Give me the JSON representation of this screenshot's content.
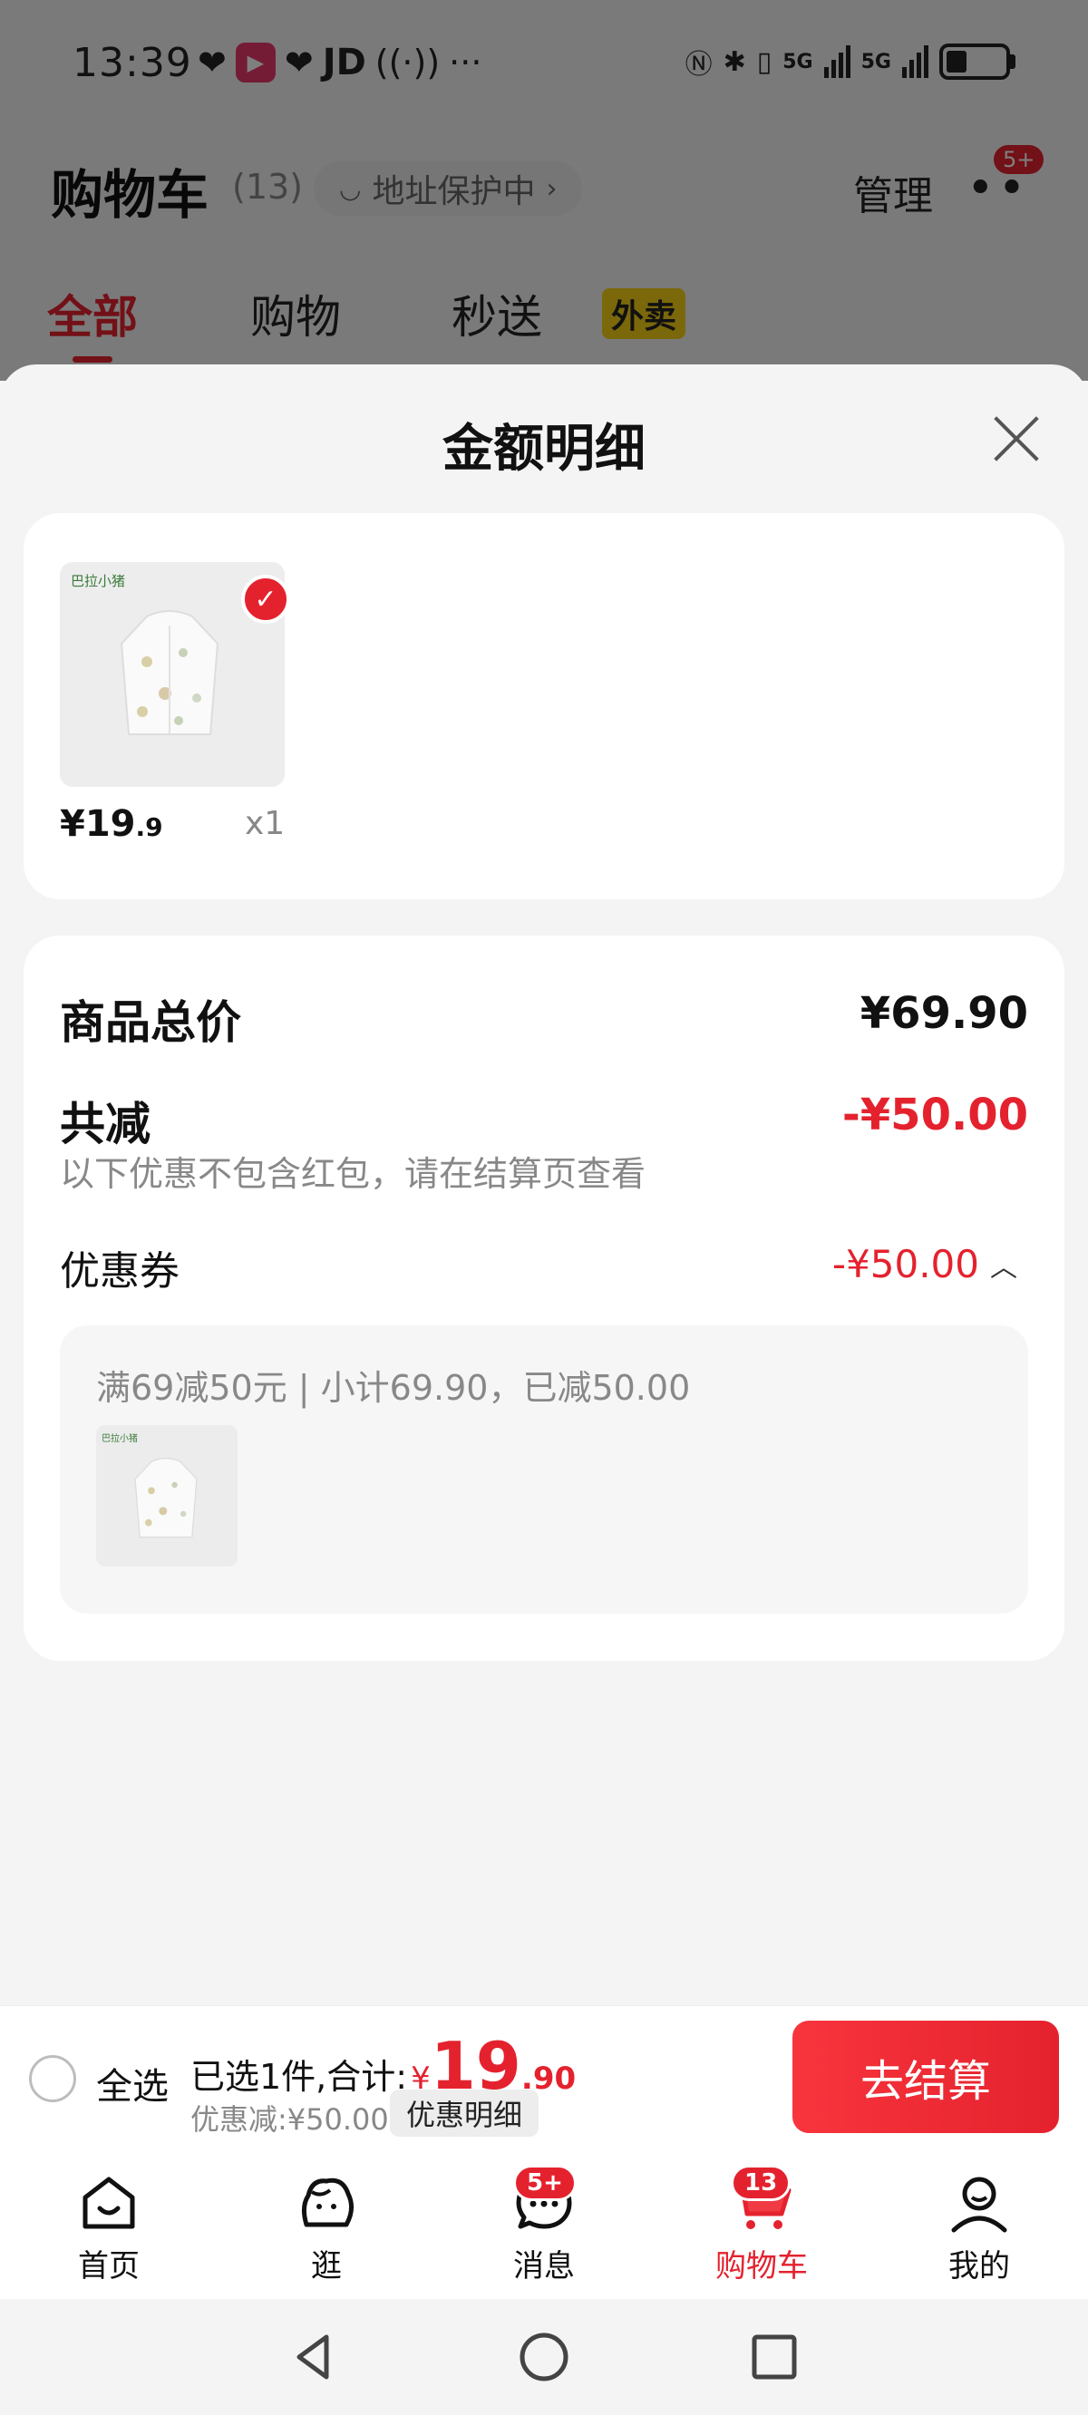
{
  "status_bar": {
    "time": "13:39",
    "left_app": "JD",
    "net_label_1": "5G",
    "net_label_2": "5G"
  },
  "header": {
    "title": "购物车",
    "count": "(13)",
    "address_pill": "地址保护中",
    "manage": "管理",
    "more_badge": "5+"
  },
  "cart_tabs": [
    {
      "label": "全部",
      "active": true
    },
    {
      "label": "购物",
      "active": false
    },
    {
      "label": "秒送",
      "active": false,
      "tag": "外卖"
    }
  ],
  "sheet": {
    "title": "金额明细",
    "product": {
      "brand": "巴拉小猪",
      "price_int": "¥19",
      "price_dec": ".9",
      "qty": "x1"
    },
    "total_label": "商品总价",
    "total_value": "¥69.90",
    "reduce_label": "共减",
    "reduce_value": "-¥50.00",
    "reduce_note": "以下优惠不包含红包，请在结算页查看",
    "coupon_label": "优惠券",
    "coupon_value": "-¥50.00",
    "coupon_detail": "满69减50元 | 小计69.90，已减50.00"
  },
  "checkout": {
    "select_all": "全选",
    "selected_text": "已选1件,合计:",
    "currency": "¥",
    "total_int": "19",
    "total_dec": ".90",
    "discount_text": "优惠减:¥50.00",
    "detail_button": "优惠明细",
    "checkout_button": "去结算"
  },
  "tab_bar": [
    {
      "label": "首页",
      "icon": "home-icon",
      "active": false
    },
    {
      "label": "逛",
      "icon": "explore-icon",
      "active": false
    },
    {
      "label": "消息",
      "icon": "message-icon",
      "active": false,
      "badge": "5+"
    },
    {
      "label": "购物车",
      "icon": "cart-icon",
      "active": true,
      "badge": "13"
    },
    {
      "label": "我的",
      "icon": "profile-icon",
      "active": false
    }
  ],
  "colors": {
    "accent": "#e4222e",
    "waimai_tag": "#f7d117"
  }
}
